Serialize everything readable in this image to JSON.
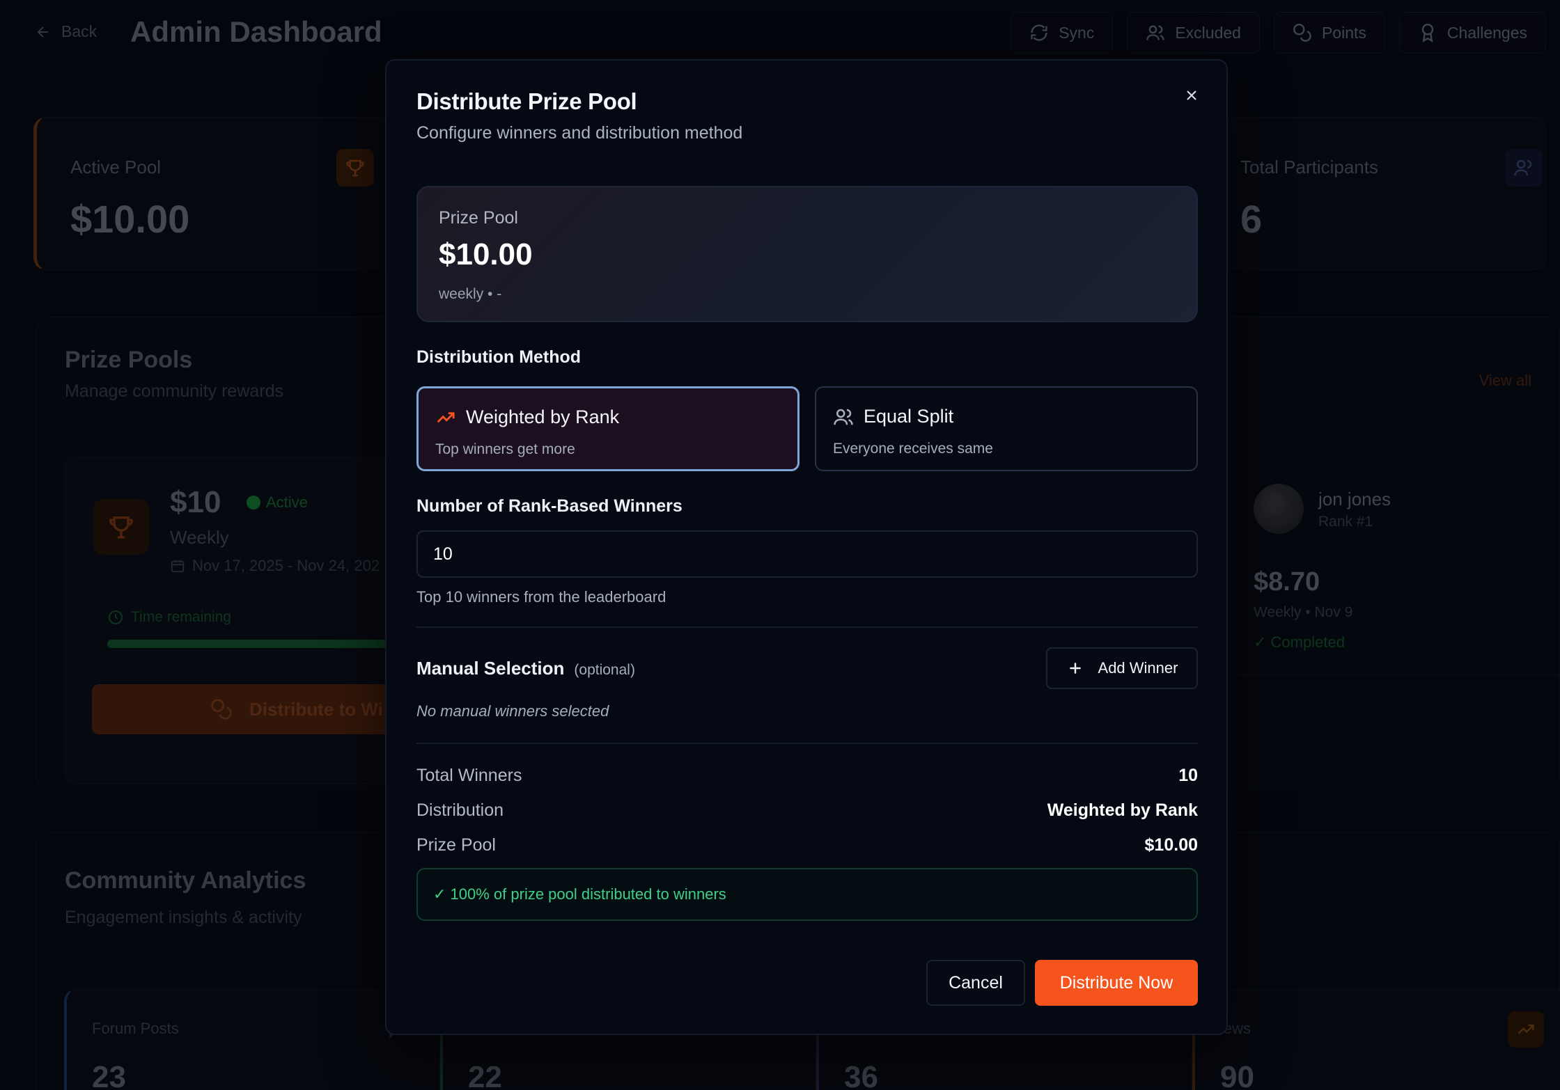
{
  "header": {
    "back_label": "Back",
    "title": "Admin Dashboard",
    "actions": [
      {
        "label": "Sync",
        "icon": "refresh-icon"
      },
      {
        "label": "Excluded",
        "icon": "users-icon"
      },
      {
        "label": "Points",
        "icon": "coins-icon"
      },
      {
        "label": "Challenges",
        "icon": "award-icon"
      }
    ]
  },
  "stats": {
    "active_pool": {
      "label": "Active Pool",
      "value": "$10.00",
      "icon": "trophy-icon"
    },
    "total_participants": {
      "label": "Total Participants",
      "value": "6",
      "icon": "users-icon"
    }
  },
  "prize_pools": {
    "title": "Prize Pools",
    "subtitle": "Manage community rewards",
    "view_all": "View all",
    "card": {
      "amount": "$10",
      "status": "Active",
      "period": "Weekly",
      "dates": "Nov 17, 2025 - Nov 24, 202",
      "time_remaining": "Time remaining",
      "distribute_label": "Distribute to Wi"
    },
    "past_winner": {
      "name": "jon jones",
      "rank": "Rank #1",
      "amount": "$8.70",
      "meta": "Weekly • Nov 9",
      "status": "✓ Completed"
    }
  },
  "analytics": {
    "title": "Community Analytics",
    "subtitle": "Engagement insights & activity",
    "metrics": [
      {
        "label": "Forum Posts",
        "value": "23"
      },
      {
        "label": "",
        "value": "22"
      },
      {
        "label": "",
        "value": "36"
      },
      {
        "label": "iews",
        "value": "90"
      }
    ]
  },
  "modal": {
    "title": "Distribute Prize Pool",
    "subtitle": "Configure winners and distribution method",
    "pool": {
      "label": "Prize Pool",
      "amount": "$10.00",
      "meta": "weekly • -"
    },
    "method_label": "Distribution Method",
    "methods": [
      {
        "title": "Weighted by Rank",
        "desc": "Top winners get more",
        "icon": "trending-up-icon",
        "selected": true
      },
      {
        "title": "Equal Split",
        "desc": "Everyone receives same",
        "icon": "users-icon",
        "selected": false
      }
    ],
    "winners_label": "Number of Rank-Based Winners",
    "winners_value": "10",
    "winners_helper": "Top 10 winners from the leaderboard",
    "manual": {
      "title": "Manual Selection",
      "optional": "(optional)",
      "add_label": "Add Winner",
      "empty": "No manual winners selected"
    },
    "summary": [
      {
        "key": "Total Winners",
        "value": "10"
      },
      {
        "key": "Distribution",
        "value": "Weighted by Rank"
      },
      {
        "key": "Prize Pool",
        "value": "$10.00"
      }
    ],
    "success": "✓ 100% of prize pool distributed to winners",
    "cancel_label": "Cancel",
    "submit_label": "Distribute Now"
  },
  "colors": {
    "accent": "#f5541d",
    "selected_border": "#7fa7d6",
    "success": "#3fcf86"
  }
}
